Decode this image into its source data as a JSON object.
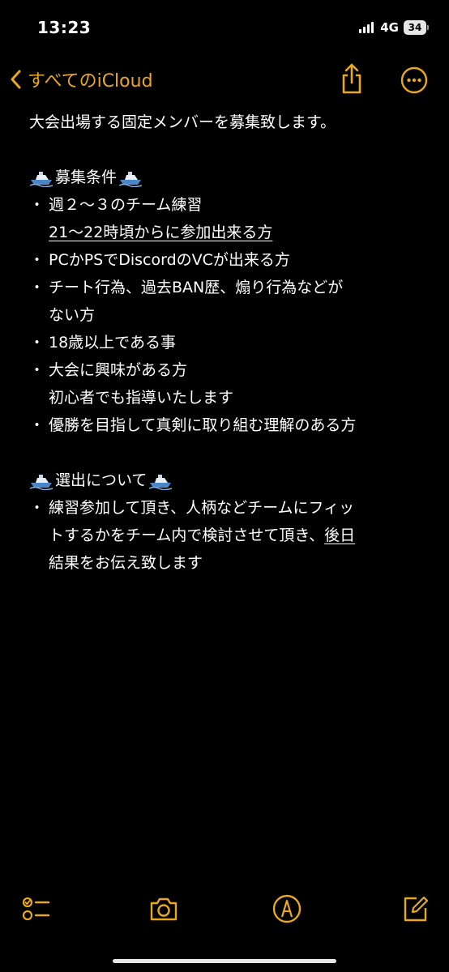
{
  "status_bar": {
    "time": "13:23",
    "network": "4G",
    "battery": "34"
  },
  "nav": {
    "back_label": "すべてのiCloud",
    "accent_color": "#e9a81d"
  },
  "note": {
    "title": "大会出場する固定メンバーを募集致します。",
    "section1": {
      "heading": "募集条件",
      "heading_icon": "boat-icon",
      "bullet_mark": "・",
      "b1_line1": "週２〜３のチーム練習",
      "b1_line2": "21〜22時頃からに参加出来る方",
      "b2_line1": "PCかPSでDiscordのVCが出来る方",
      "b3_line1": "チート行為、過去BAN歴、煽り行為などが",
      "b3_line2": "ない方",
      "b4_line1": "18歳以上である事",
      "b5_line1": "大会に興味がある方",
      "b5_line2": "初心者でも指導いたします",
      "b6_line1": "優勝を目指して真剣に取り組む理解のある方"
    },
    "section2": {
      "heading": "選出について",
      "heading_icon": "boat-icon",
      "b1_line1": "練習参加して頂き、人柄などチームにフィッ",
      "b1_line2_pre": "トするかをチーム内で検討させて頂き、",
      "b1_line2_ul": "後日",
      "b1_line3": "結果をお伝え致します"
    }
  },
  "toolbar": {
    "icons": [
      "checklist-icon",
      "camera-icon",
      "markup-icon",
      "compose-icon"
    ]
  }
}
